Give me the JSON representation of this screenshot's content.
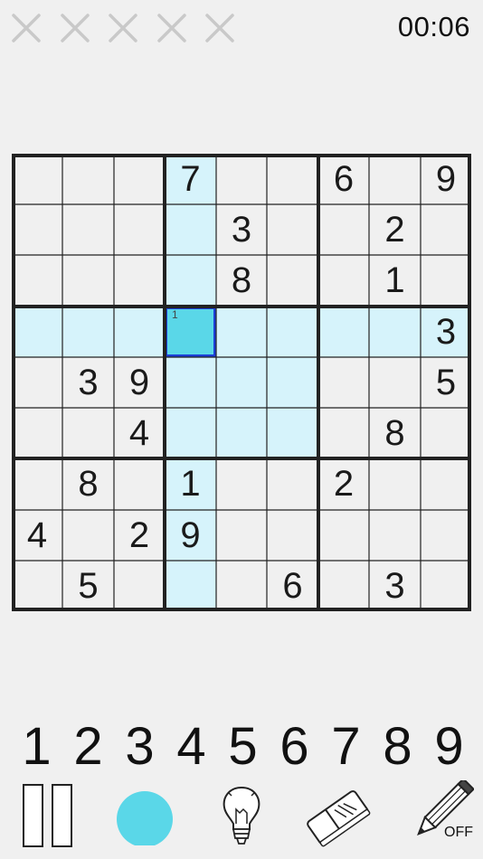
{
  "header": {
    "timer": "00:06",
    "mistakes": [
      {
        "icon": "cross-icon",
        "color": "#c9c9c9"
      },
      {
        "icon": "cross-icon",
        "color": "#c9c9c9"
      },
      {
        "icon": "cross-icon",
        "color": "#c9c9c9"
      },
      {
        "icon": "cross-icon",
        "color": "#c9c9c9"
      },
      {
        "icon": "cross-icon",
        "color": "#c9c9c9"
      }
    ]
  },
  "board": {
    "grid": [
      [
        "",
        "",
        "",
        "7",
        "",
        "",
        "6",
        "",
        "9"
      ],
      [
        "",
        "",
        "",
        "",
        "3",
        "",
        "",
        "2",
        ""
      ],
      [
        "",
        "",
        "",
        "",
        "8",
        "",
        "",
        "1",
        ""
      ],
      [
        "",
        "",
        "",
        "",
        "",
        "",
        "",
        "",
        "3"
      ],
      [
        "",
        "3",
        "9",
        "",
        "",
        "",
        "",
        "",
        "5"
      ],
      [
        "",
        "",
        "4",
        "",
        "",
        "",
        "",
        "8",
        ""
      ],
      [
        "",
        "8",
        "",
        "1",
        "",
        "",
        "2",
        "",
        ""
      ],
      [
        "4",
        "",
        "2",
        "9",
        "",
        "",
        "",
        "",
        ""
      ],
      [
        "",
        "5",
        "",
        "",
        "",
        "6",
        "",
        "3",
        ""
      ]
    ],
    "selected": {
      "row": 3,
      "col": 3
    },
    "notes": [
      {
        "row": 3,
        "col": 3,
        "text": "1"
      }
    ],
    "colors": {
      "highlight": "#d6f3fb",
      "selected": "#5ad7e8",
      "selected_border": "#1b3fd6",
      "lines": "#222222"
    }
  },
  "numpad": [
    "1",
    "2",
    "3",
    "4",
    "5",
    "6",
    "7",
    "8",
    "9"
  ],
  "toolbar": {
    "pause_icon": "pause-icon",
    "color_icon": "color-dot-icon",
    "color_value": "#5ad7e8",
    "hint_icon": "lightbulb-icon",
    "erase_icon": "eraser-icon",
    "pencil_icon": "pencil-icon",
    "pencil_state": "OFF"
  }
}
